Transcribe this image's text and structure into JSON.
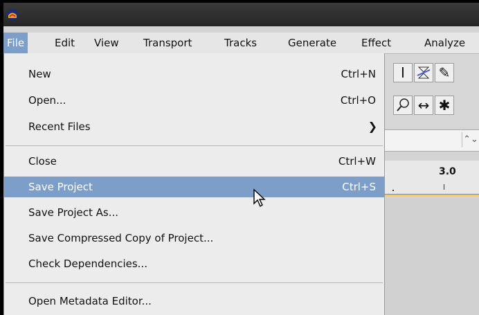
{
  "menubar": {
    "menus": [
      {
        "label": "File"
      },
      {
        "label": "Edit"
      },
      {
        "label": "View"
      },
      {
        "label": "Transport"
      },
      {
        "label": "Tracks"
      },
      {
        "label": "Generate"
      },
      {
        "label": "Effect"
      },
      {
        "label": "Analyze"
      }
    ]
  },
  "file_menu": {
    "items": [
      {
        "label": "New",
        "shortcut": "Ctrl+N"
      },
      {
        "label": "Open...",
        "shortcut": "Ctrl+O"
      },
      {
        "label": "Recent Files"
      },
      {
        "label": "Close",
        "shortcut": "Ctrl+W"
      },
      {
        "label": "Save Project",
        "shortcut": "Ctrl+S",
        "highlighted": true
      },
      {
        "label": "Save Project As..."
      },
      {
        "label": "Save Compressed Copy of Project..."
      },
      {
        "label": "Check Dependencies..."
      },
      {
        "label": "Open Metadata Editor..."
      }
    ]
  },
  "timeline": {
    "ruler_value": "3.0"
  },
  "colors": {
    "highlight": "#7c9ec9",
    "menu_bg": "#ececec",
    "titlebar": "#2a2a2a"
  },
  "icons": {
    "app": "audacity-logo-icon",
    "submenu": "chevron-right-icon",
    "tools": [
      "ibeam-icon",
      "envelope-icon",
      "pencil-icon",
      "zoom-icon",
      "time-shift-icon",
      "multi-tool-icon"
    ],
    "cursor": "mouse-pointer-icon"
  }
}
